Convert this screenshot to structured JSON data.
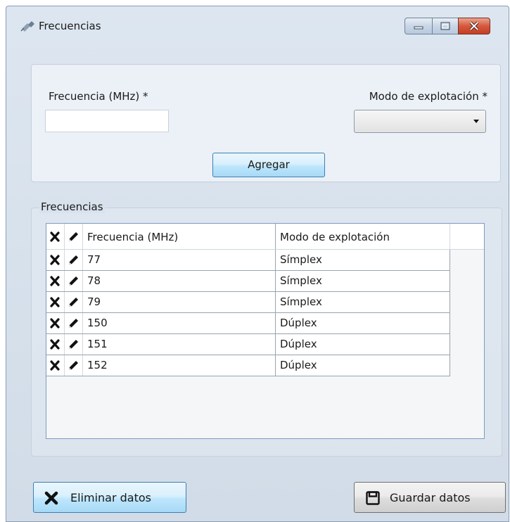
{
  "window": {
    "title": "Frecuencias",
    "icon": "satellite-icon",
    "controls": [
      "minimize-icon",
      "maximize-icon",
      "close-icon"
    ]
  },
  "form": {
    "frequency_label": "Frecuencia (MHz) *",
    "frequency_value": "",
    "mode_label": "Modo de explotación *",
    "mode_value": "",
    "add_button": "Agregar"
  },
  "group": {
    "title": "Frecuencias"
  },
  "grid": {
    "columns": {
      "delete": "delete-icon",
      "edit": "pencil-icon",
      "frequency": "Frecuencia (MHz)",
      "mode": "Modo de explotación"
    },
    "rows": [
      {
        "frequency": "77",
        "mode": "Símplex"
      },
      {
        "frequency": "78",
        "mode": "Símplex"
      },
      {
        "frequency": "79",
        "mode": "Símplex"
      },
      {
        "frequency": "150",
        "mode": "Dúplex"
      },
      {
        "frequency": "151",
        "mode": "Dúplex"
      },
      {
        "frequency": "152",
        "mode": "Dúplex"
      }
    ]
  },
  "actions": {
    "delete_label": "Eliminar datos",
    "delete_icon": "x-icon",
    "save_label": "Guardar datos",
    "save_icon": "floppy-disk-icon"
  },
  "colors": {
    "accent_border": "#3c7fb1",
    "close_button": "#c33d24",
    "grid_border": "#7b9cc0"
  }
}
